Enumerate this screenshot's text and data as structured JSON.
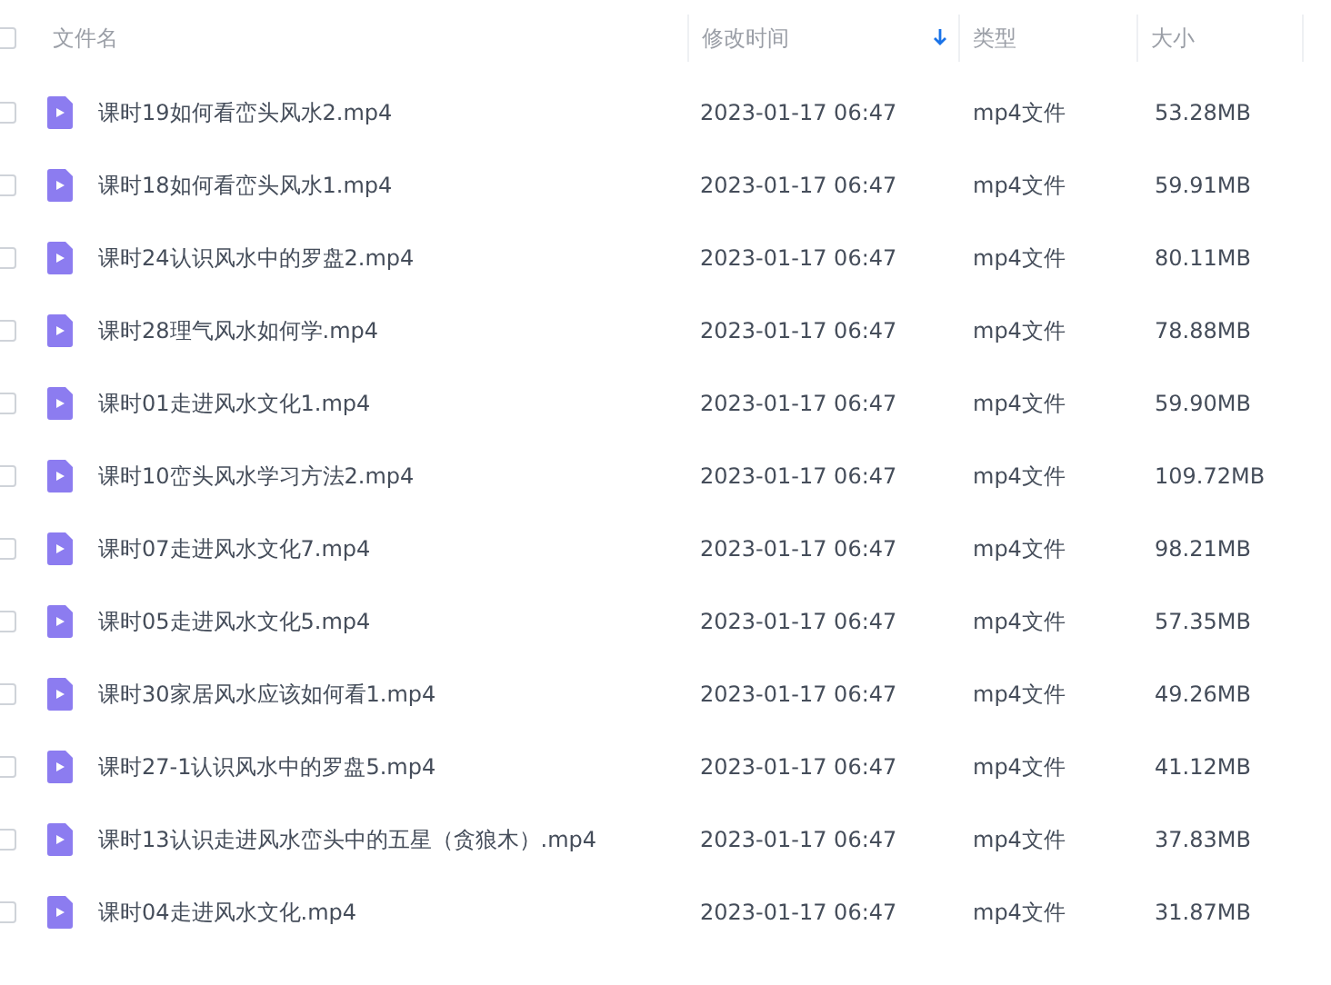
{
  "table": {
    "select_all": {
      "checked": false
    },
    "columns": [
      {
        "label": "文件名",
        "sorted": false
      },
      {
        "label": "修改时间",
        "sorted": true
      },
      {
        "label": "类型",
        "sorted": false
      },
      {
        "label": "大小",
        "sorted": false
      }
    ],
    "rows": [
      {
        "checked": false,
        "name": "课时19如何看峦头风水2.mp4",
        "modified": "2023-01-17 06:47",
        "type": "mp4文件",
        "size": "53.28MB"
      },
      {
        "checked": false,
        "name": "课时18如何看峦头风水1.mp4",
        "modified": "2023-01-17 06:47",
        "type": "mp4文件",
        "size": "59.91MB"
      },
      {
        "checked": false,
        "name": "课时24认识风水中的罗盘2.mp4",
        "modified": "2023-01-17 06:47",
        "type": "mp4文件",
        "size": "80.11MB"
      },
      {
        "checked": false,
        "name": "课时28理气风水如何学.mp4",
        "modified": "2023-01-17 06:47",
        "type": "mp4文件",
        "size": "78.88MB"
      },
      {
        "checked": false,
        "name": "课时01走进风水文化1.mp4",
        "modified": "2023-01-17 06:47",
        "type": "mp4文件",
        "size": "59.90MB"
      },
      {
        "checked": false,
        "name": "课时10峦头风水学习方法2.mp4",
        "modified": "2023-01-17 06:47",
        "type": "mp4文件",
        "size": "109.72MB"
      },
      {
        "checked": false,
        "name": "课时07走进风水文化7.mp4",
        "modified": "2023-01-17 06:47",
        "type": "mp4文件",
        "size": "98.21MB"
      },
      {
        "checked": false,
        "name": "课时05走进风水文化5.mp4",
        "modified": "2023-01-17 06:47",
        "type": "mp4文件",
        "size": "57.35MB"
      },
      {
        "checked": false,
        "name": "课时30家居风水应该如何看1.mp4",
        "modified": "2023-01-17 06:47",
        "type": "mp4文件",
        "size": "49.26MB"
      },
      {
        "checked": false,
        "name": "课时27-1认识风水中的罗盘5.mp4",
        "modified": "2023-01-17 06:47",
        "type": "mp4文件",
        "size": "41.12MB"
      },
      {
        "checked": false,
        "name": "课时13认识走进风水峦头中的五星（贪狼木）.mp4",
        "modified": "2023-01-17 06:47",
        "type": "mp4文件",
        "size": "37.83MB"
      },
      {
        "checked": false,
        "name": "课时04走进风水文化.mp4",
        "modified": "2023-01-17 06:47",
        "type": "mp4文件",
        "size": "31.87MB"
      }
    ]
  }
}
